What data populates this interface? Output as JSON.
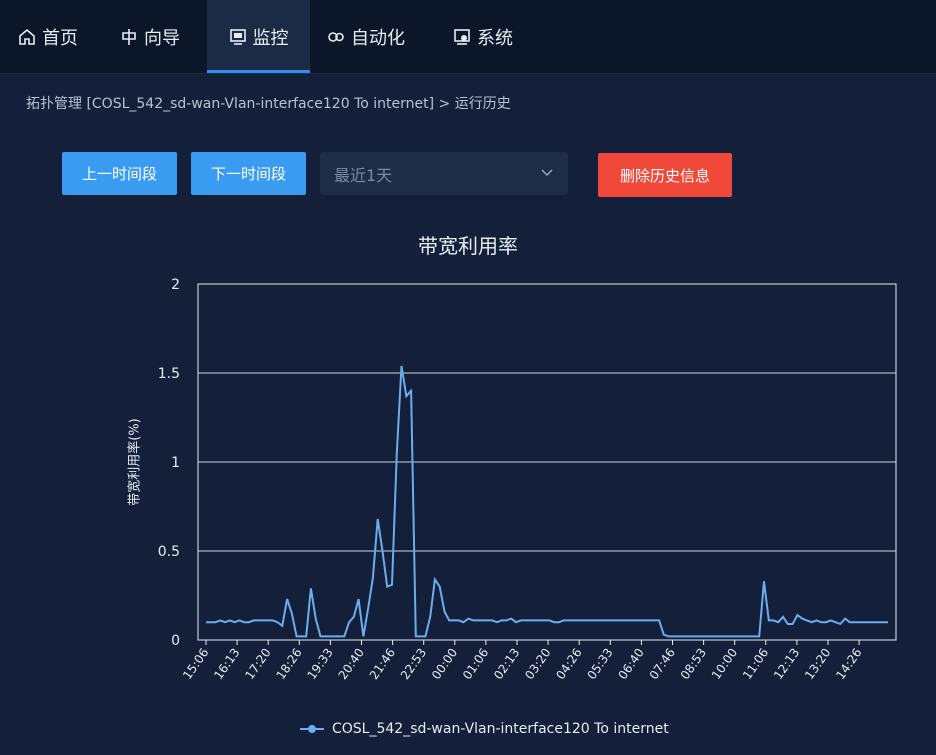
{
  "nav": [
    {
      "label": "首页",
      "icon": "home-icon"
    },
    {
      "label": "向导",
      "icon": "guide-icon"
    },
    {
      "label": "监控",
      "icon": "monitor-icon",
      "active": true
    },
    {
      "label": "自动化",
      "icon": "automation-icon"
    },
    {
      "label": "系统",
      "icon": "system-icon"
    }
  ],
  "breadcrumb": "拓扑管理 [COSL_542_sd-wan-Vlan-interface120 To internet] > 运行历史",
  "toolbar": {
    "prev_label": "上一时间段",
    "next_label": "下一时间段",
    "range_value": "最近1天",
    "delete_label": "删除历史信息"
  },
  "colors": {
    "line": "#6aaef0",
    "accent": "#3a9cf0",
    "danger": "#f0493a"
  },
  "chart_data": {
    "type": "line",
    "title": "带宽利用率",
    "xlabel": "",
    "ylabel": "带宽利用率(%)",
    "ylim": [
      0,
      2
    ],
    "yticks": [
      "0",
      "0.5",
      "1",
      "1.5",
      "2"
    ],
    "grid": true,
    "legend_position": "bottom",
    "categories": [
      "15:06",
      "16:13",
      "17:20",
      "18:26",
      "19:33",
      "20:40",
      "21:46",
      "22:53",
      "00:00",
      "01:06",
      "02:13",
      "03:20",
      "04:26",
      "05:33",
      "06:40",
      "07:46",
      "08:53",
      "10:00",
      "11:06",
      "12:13",
      "13:20",
      "14:26"
    ],
    "series": [
      {
        "name": "COSL_542_sd-wan-Vlan-interface120 To internet",
        "values": [
          0.1,
          0.1,
          0.1,
          0.11,
          0.1,
          0.11,
          0.1,
          0.11,
          0.1,
          0.1,
          0.11,
          0.11,
          0.11,
          0.11,
          0.11,
          0.1,
          0.08,
          0.23,
          0.15,
          0.02,
          0.02,
          0.02,
          0.29,
          0.12,
          0.02,
          0.02,
          0.02,
          0.02,
          0.02,
          0.02,
          0.1,
          0.13,
          0.23,
          0.02,
          0.18,
          0.35,
          0.68,
          0.5,
          0.3,
          0.31,
          1.05,
          1.54,
          1.37,
          1.4,
          0.02,
          0.02,
          0.02,
          0.13,
          0.34,
          0.3,
          0.16,
          0.11,
          0.11,
          0.11,
          0.1,
          0.12,
          0.11,
          0.11,
          0.11,
          0.11,
          0.11,
          0.1,
          0.11,
          0.11,
          0.12,
          0.1,
          0.11,
          0.11,
          0.11,
          0.11,
          0.11,
          0.11,
          0.11,
          0.1,
          0.1,
          0.11,
          0.11,
          0.11,
          0.11,
          0.11,
          0.11,
          0.11,
          0.11,
          0.11,
          0.11,
          0.11,
          0.11,
          0.11,
          0.11,
          0.11,
          0.11,
          0.11,
          0.11,
          0.11,
          0.11,
          0.11,
          0.03,
          0.02,
          0.02,
          0.02,
          0.02,
          0.02,
          0.02,
          0.02,
          0.02,
          0.02,
          0.02,
          0.02,
          0.02,
          0.02,
          0.02,
          0.02,
          0.02,
          0.02,
          0.02,
          0.02,
          0.02,
          0.33,
          0.11,
          0.11,
          0.1,
          0.13,
          0.09,
          0.09,
          0.14,
          0.12,
          0.11,
          0.1,
          0.11,
          0.1,
          0.1,
          0.11,
          0.1,
          0.09,
          0.12,
          0.1,
          0.1,
          0.1,
          0.1,
          0.1,
          0.1,
          0.1,
          0.1,
          0.1
        ]
      }
    ]
  }
}
